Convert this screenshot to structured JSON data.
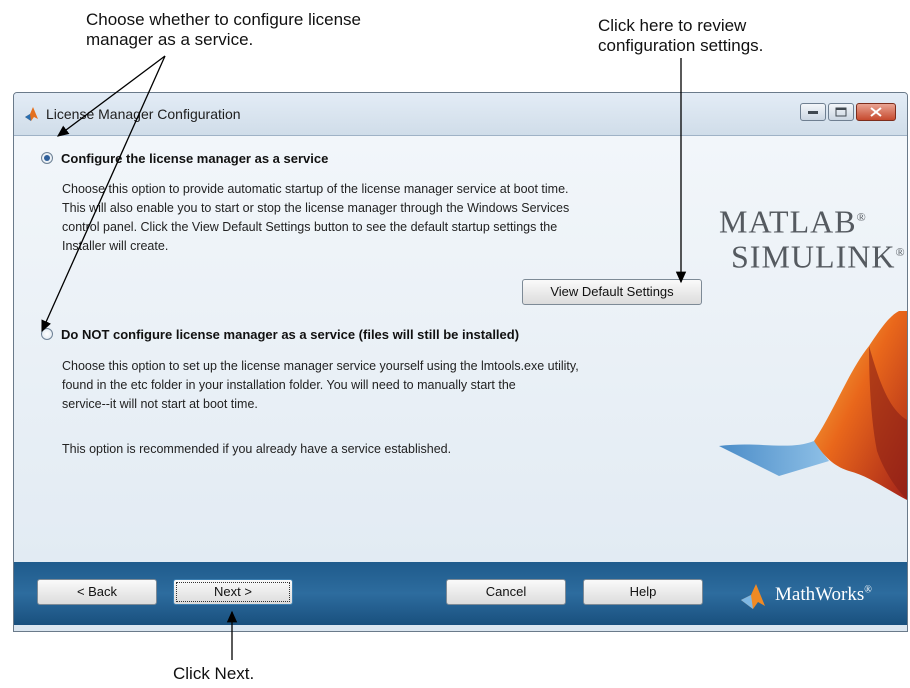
{
  "annotations": {
    "top_left": [
      "Choose whether to configure license",
      "manager as a service."
    ],
    "top_right": [
      "Click here to review",
      "configuration settings."
    ],
    "bottom": "Click Next."
  },
  "window": {
    "title": "License Manager Configuration"
  },
  "options": [
    {
      "label": "Configure the license manager as a service",
      "selected": true,
      "description_lines": [
        "Choose this option to provide automatic startup of the license manager service at boot time.",
        "This will also enable you to start or stop the license manager through the Windows Services",
        "control panel. Click the View Default Settings button to see the default startup settings the",
        "Installer will create."
      ]
    },
    {
      "label": "Do NOT configure license manager as a service (files will still be installed)",
      "selected": false,
      "description_lines": [
        "Choose this option to set up the license manager service yourself using the lmtools.exe utility,",
        "found in the etc folder in your installation folder. You will need to manually start the",
        "service--it will not start at boot time."
      ],
      "note": "This option is recommended if you already have a service established."
    }
  ],
  "buttons": {
    "view_default_settings": "View Default Settings",
    "back": "< Back",
    "next": "Next >",
    "cancel": "Cancel",
    "help": "Help"
  },
  "branding": {
    "logo_line1": "MATLAB",
    "logo_line2": "SIMULINK",
    "registered_mark": "®",
    "footer_logo": "MathWorks",
    "footer_mark": "®"
  },
  "colors": {
    "footer_bar": "#1f5b8c",
    "content_bg": "#eef3f8",
    "radio_selected": "#2f5f9a",
    "arrows": "#000000"
  }
}
